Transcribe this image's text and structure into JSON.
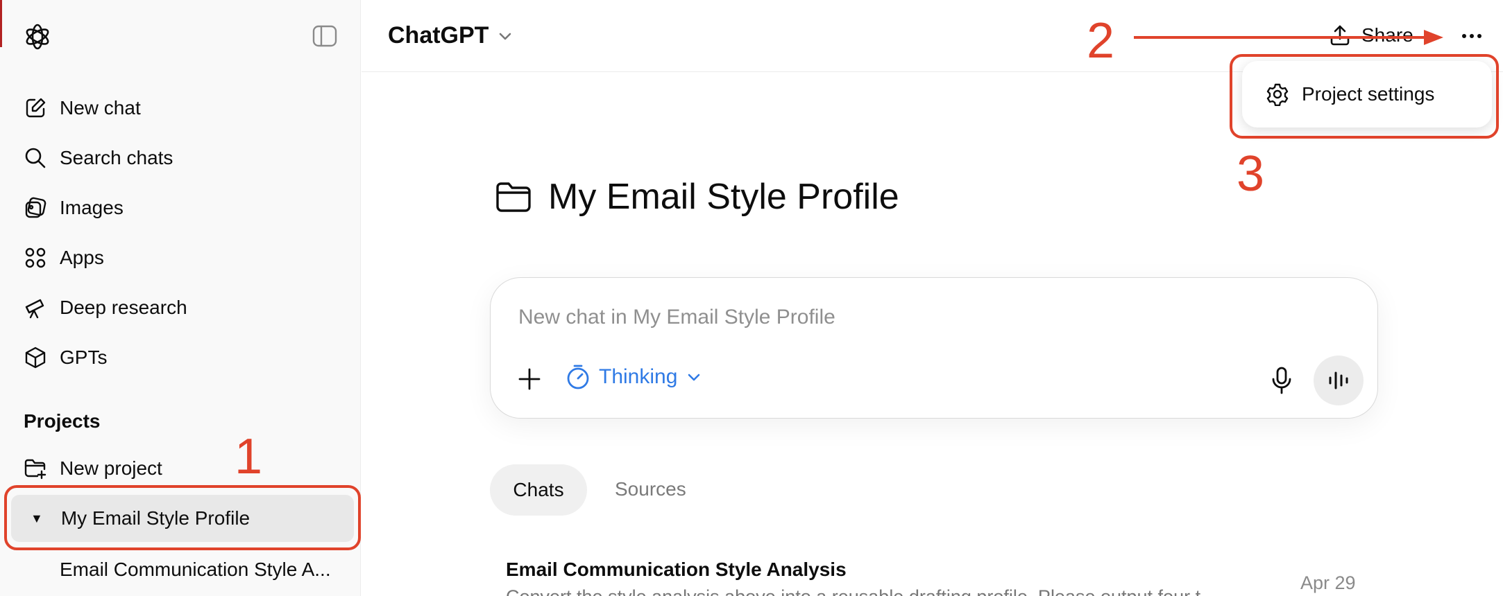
{
  "sidebar": {
    "nav": [
      {
        "label": "New chat",
        "icon": "new-chat-icon"
      },
      {
        "label": "Search chats",
        "icon": "search-icon"
      },
      {
        "label": "Images",
        "icon": "images-icon"
      },
      {
        "label": "Apps",
        "icon": "apps-icon"
      },
      {
        "label": "Deep research",
        "icon": "telescope-icon"
      },
      {
        "label": "GPTs",
        "icon": "cube-icon"
      }
    ],
    "projects_title": "Projects",
    "new_project": "New project",
    "active_project": "My Email Style Profile",
    "project_chat": "Email Communication Style A..."
  },
  "header": {
    "model": "ChatGPT",
    "share": "Share"
  },
  "menu": {
    "project_settings": "Project settings"
  },
  "main": {
    "project_title": "My Email Style Profile",
    "composer_placeholder": "New chat in My Email Style Profile",
    "thinking_label": "Thinking",
    "tabs": [
      {
        "label": "Chats"
      },
      {
        "label": "Sources"
      }
    ],
    "chat_row": {
      "title": "Email Communication Style Analysis",
      "snippet": "Convert the style analysis above into a reusable drafting profile. Please output four t",
      "date": "Apr 29"
    }
  },
  "annotations": {
    "step1": "1",
    "step2": "2",
    "step3": "3",
    "color": "#e0432b"
  }
}
